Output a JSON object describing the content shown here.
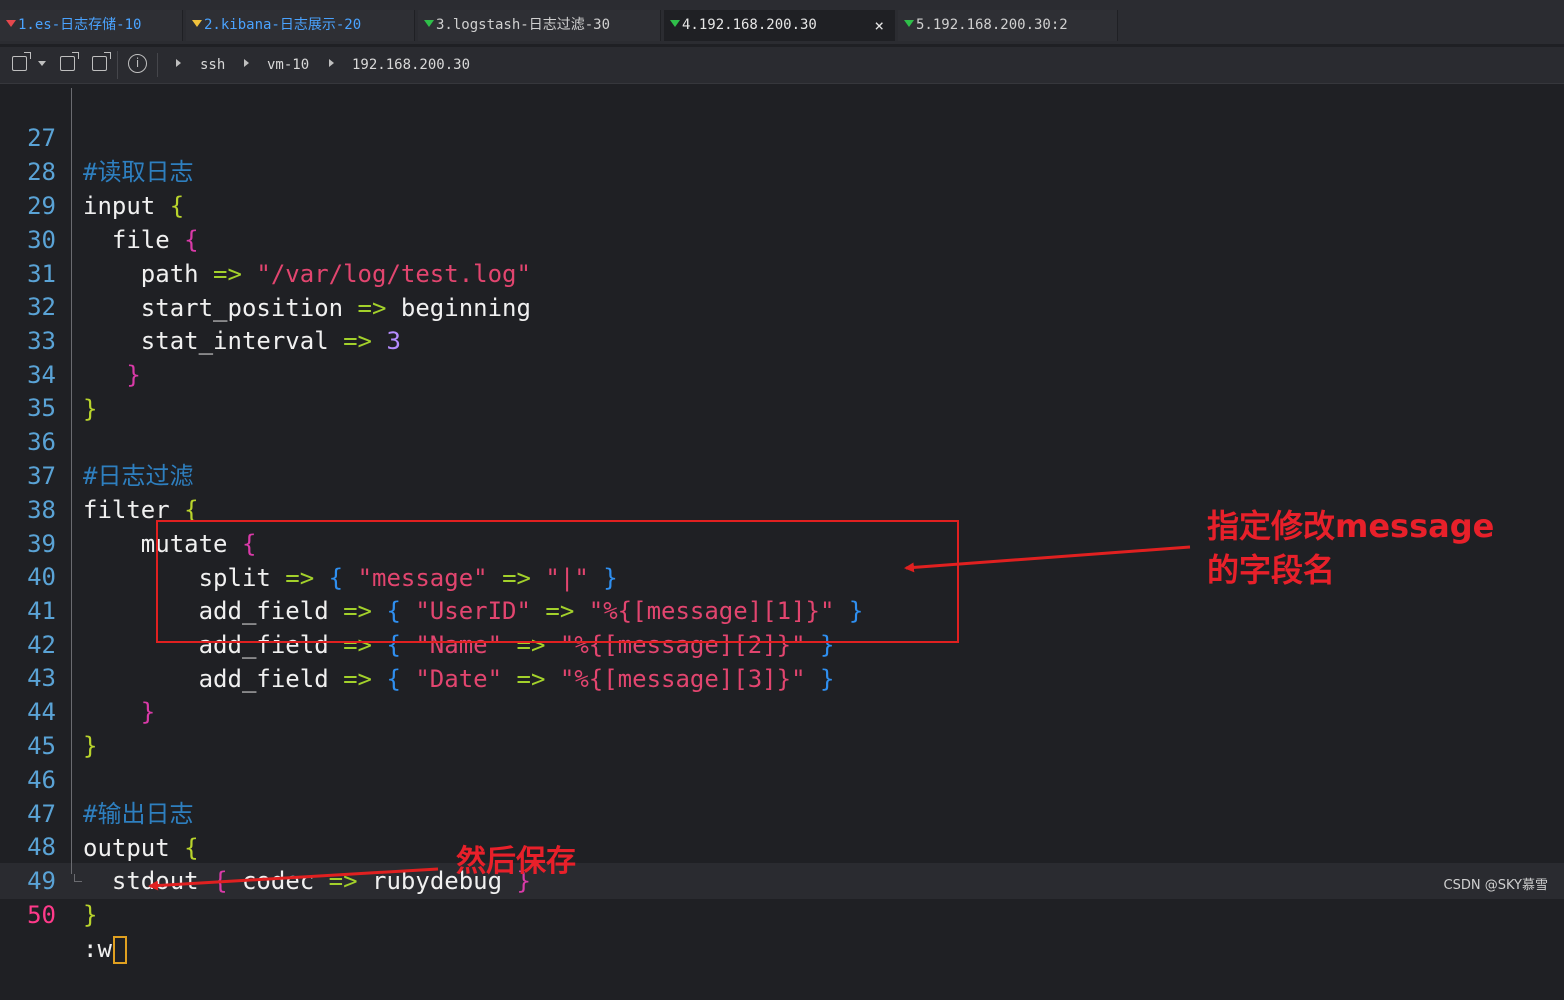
{
  "tabs": [
    {
      "label": "1.es-日志存储-10"
    },
    {
      "label": "2.kibana-日志展示-20"
    },
    {
      "label": "3.logstash-日志过滤-30"
    },
    {
      "label": "4.192.168.200.30",
      "close": "×"
    },
    {
      "label": "5.192.168.200.30:2"
    }
  ],
  "toolbar": {
    "info": "i",
    "breadcrumb": [
      "ssh",
      "vm-10",
      "192.168.200.30"
    ]
  },
  "editor": {
    "lines": [
      {
        "n": "27"
      },
      {
        "n": "28"
      },
      {
        "n": "29"
      },
      {
        "n": "30"
      },
      {
        "n": "31"
      },
      {
        "n": "32"
      },
      {
        "n": "33"
      },
      {
        "n": "34"
      },
      {
        "n": "35"
      },
      {
        "n": "36"
      },
      {
        "n": "37"
      },
      {
        "n": "38"
      },
      {
        "n": "39"
      },
      {
        "n": "40"
      },
      {
        "n": "41"
      },
      {
        "n": "42"
      },
      {
        "n": "43"
      },
      {
        "n": "44"
      },
      {
        "n": "45"
      },
      {
        "n": "46"
      },
      {
        "n": "47"
      },
      {
        "n": "48"
      },
      {
        "n": "49"
      },
      {
        "n": "50"
      }
    ],
    "t": {
      "c27": "#读取日志",
      "input": "input",
      "file": "file",
      "path": "path",
      "arrow": "=>",
      "path_val": "\"/var/log/test.log\"",
      "start_position": "start_position",
      "beginning": "beginning",
      "stat_interval": "stat_interval",
      "three": "3",
      "lb": "{",
      "rb": "}",
      "c36": "#日志过滤",
      "filter": "filter",
      "mutate": "mutate",
      "split": "split",
      "message": "\"message\"",
      "pipe": "\"|\"",
      "add_field": "add_field",
      "userid": "\"UserID\"",
      "m1": "\"%{[message][1]}\"",
      "name": "\"Name\"",
      "m2": "\"%{[message][2]}\"",
      "date": "\"Date\"",
      "m3": "\"%{[message][3]}\"",
      "c46": "#输出日志",
      "output": "output",
      "stdout": "stdout",
      "codec": "codec",
      "rubydebug": "rubydebug"
    },
    "command": ":w"
  },
  "annotations": {
    "note1_line1": "指定修改message",
    "note1_line2": "的字段名",
    "note2": "然后保存"
  },
  "watermark": "CSDN @SKY慕雪",
  "colors": {
    "accent_annotation": "#e02020",
    "line_number": "#5aa3d6",
    "current_line_number": "#ff3a8a",
    "cursor": "#e0a020"
  }
}
